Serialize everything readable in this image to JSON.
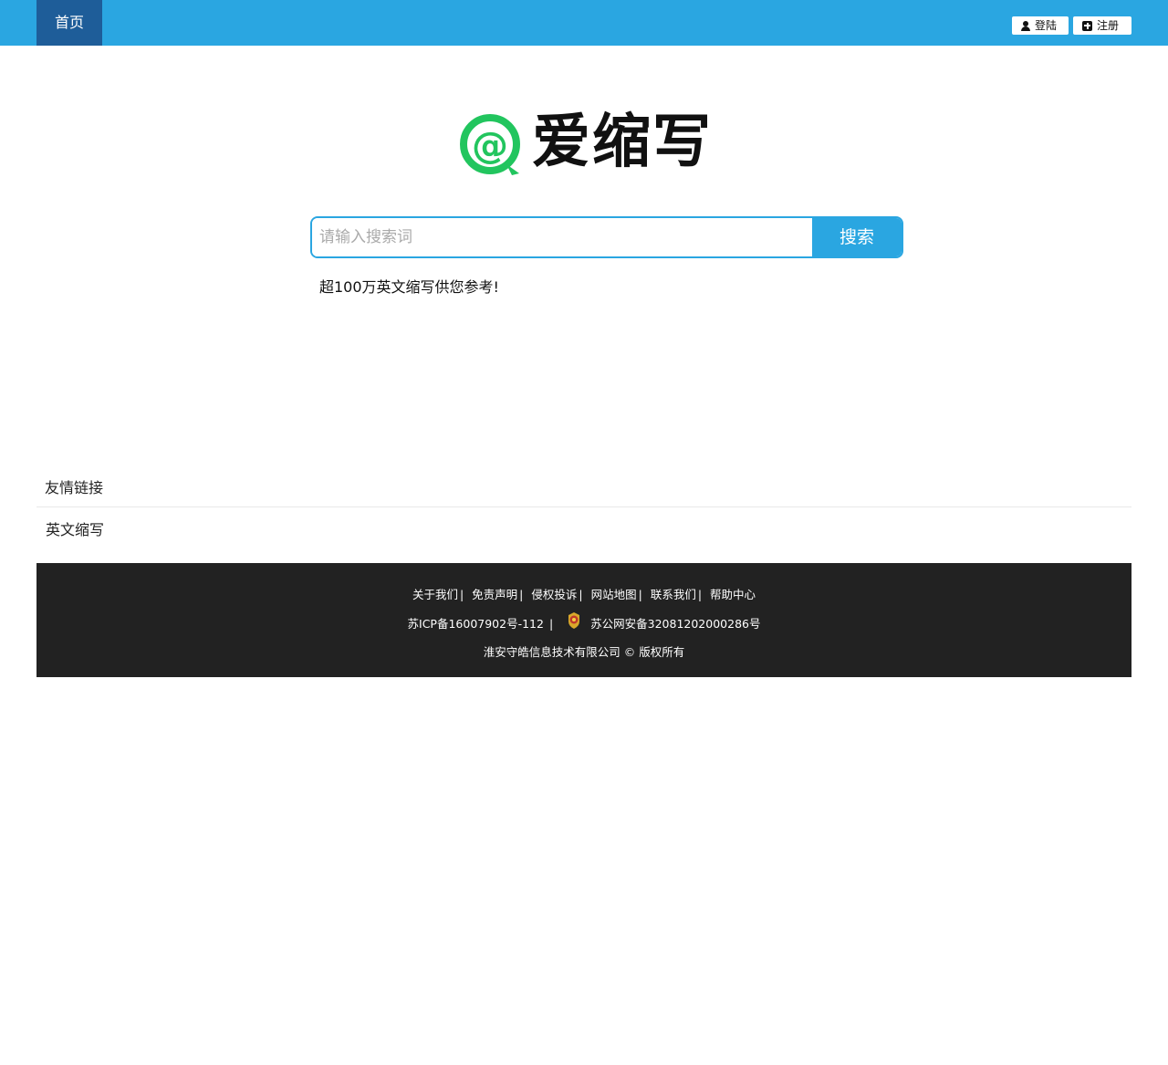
{
  "nav": {
    "home_label": "首页"
  },
  "auth": {
    "login_label": "登陆",
    "register_label": "注册"
  },
  "logo": {
    "text": "爱缩写",
    "mark_glyph": "@",
    "brand_color": "#22c55e"
  },
  "search": {
    "placeholder": "请输入搜索词",
    "value": "",
    "button_label": "搜索"
  },
  "tagline": "超100万英文缩写供您参考!",
  "friend_links": {
    "title": "友情链接",
    "items": [
      "英文缩写"
    ]
  },
  "footer": {
    "links": [
      "关于我们",
      "免责声明",
      "侵权投诉",
      "网站地图",
      "联系我们",
      "帮助中心"
    ],
    "separator": "|",
    "icp": "苏ICP备16007902号-112",
    "police_record": "苏公网安备32081202000286号",
    "copyright": "淮安守皓信息技术有限公司 © 版权所有"
  },
  "colors": {
    "topbar": "#2aa6e1",
    "nav_active": "#1e5d99",
    "footer_bg": "#222222"
  }
}
